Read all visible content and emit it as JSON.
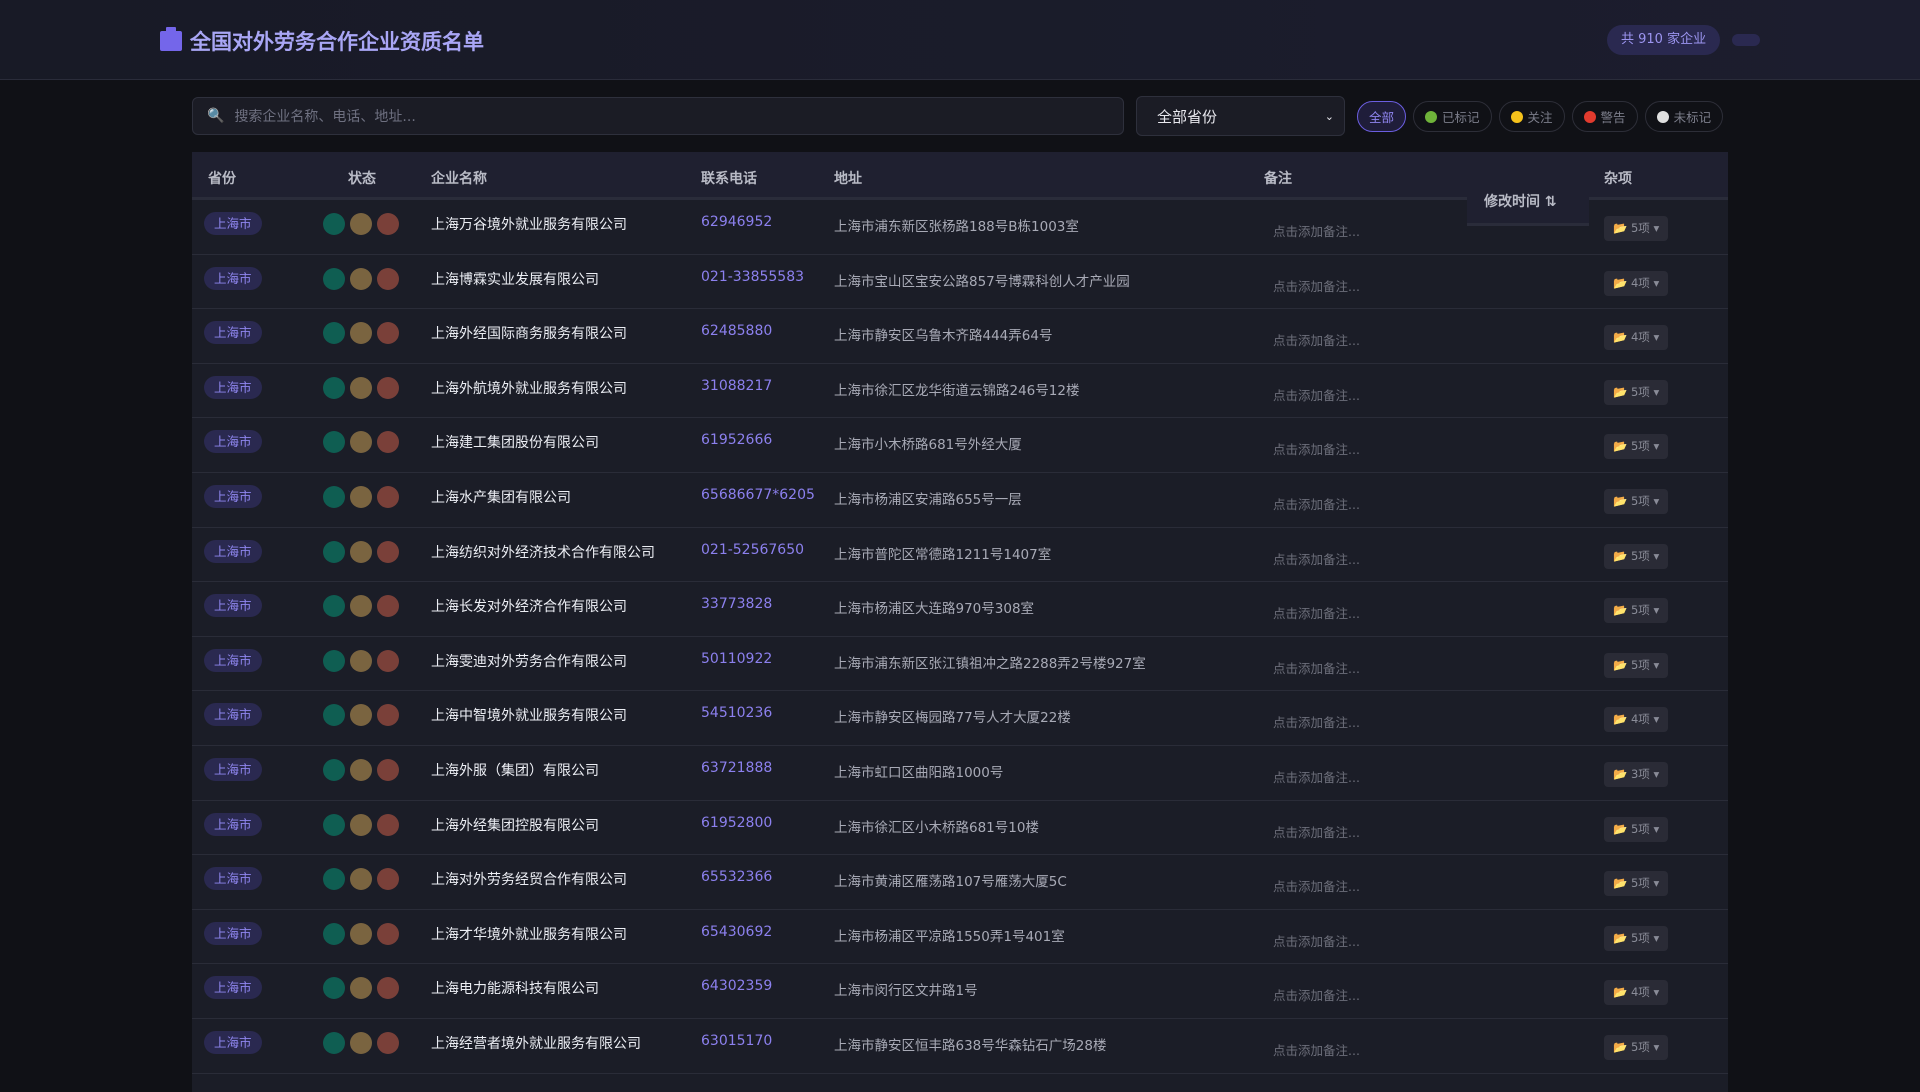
{
  "header": {
    "title": "全国对外劳务合作企业资质名单",
    "count": "共 910 家企业"
  },
  "toolbar": {
    "search_placeholder": "搜索企业名称、电话、地址...",
    "province_select": "全部省份",
    "filters": [
      {
        "label": "全部",
        "active": true
      },
      {
        "label": "已标记",
        "color": "#6fb33a"
      },
      {
        "label": "关注",
        "color": "#f5c21b"
      },
      {
        "label": "警告",
        "color": "#e23b2e"
      },
      {
        "label": "未标记",
        "color": "#e0e0e0"
      }
    ]
  },
  "table": {
    "columns": [
      "省份",
      "状态",
      "企业名称",
      "联系电话",
      "地址",
      "备注",
      "修改时间 ⇅",
      "杂项"
    ],
    "note_placeholder": "点击添加备注...",
    "status_colors": [
      "#0f5e52",
      "#7a6440",
      "#7a4039"
    ],
    "rows": [
      {
        "province": "上海市",
        "name": "上海万谷境外就业服务有限公司",
        "phone": "62946952",
        "address": "上海市浦东新区张杨路188号B栋1003室",
        "misc": "5项"
      },
      {
        "province": "上海市",
        "name": "上海博霖实业发展有限公司",
        "phone": "021-33855583",
        "address": "上海市宝山区宝安公路857号博霖科创人才产业园",
        "misc": "4项"
      },
      {
        "province": "上海市",
        "name": "上海外经国际商务服务有限公司",
        "phone": "62485880",
        "address": "上海市静安区乌鲁木齐路444弄64号",
        "misc": "4项"
      },
      {
        "province": "上海市",
        "name": "上海外航境外就业服务有限公司",
        "phone": "31088217",
        "address": "上海市徐汇区龙华街道云锦路246号12楼",
        "misc": "5项"
      },
      {
        "province": "上海市",
        "name": "上海建工集团股份有限公司",
        "phone": "61952666",
        "address": "上海市小木桥路681号外经大厦",
        "misc": "5项"
      },
      {
        "province": "上海市",
        "name": "上海水产集团有限公司",
        "phone": "65686677*6205",
        "address": "上海市杨浦区安浦路655号一层",
        "misc": "5项"
      },
      {
        "province": "上海市",
        "name": "上海纺织对外经济技术合作有限公司",
        "phone": "021-52567650",
        "address": "上海市普陀区常德路1211号1407室",
        "misc": "5项"
      },
      {
        "province": "上海市",
        "name": "上海长发对外经济合作有限公司",
        "phone": "33773828",
        "address": "上海市杨浦区大连路970号308室",
        "misc": "5项"
      },
      {
        "province": "上海市",
        "name": "上海雯迪对外劳务合作有限公司",
        "phone": "50110922",
        "address": "上海市浦东新区张江镇祖冲之路2288弄2号楼927室",
        "misc": "5项"
      },
      {
        "province": "上海市",
        "name": "上海中智境外就业服务有限公司",
        "phone": "54510236",
        "address": "上海市静安区梅园路77号人才大厦22楼",
        "misc": "4项"
      },
      {
        "province": "上海市",
        "name": "上海外服（集团）有限公司",
        "phone": "63721888",
        "address": "上海市虹口区曲阳路1000号",
        "misc": "3项"
      },
      {
        "province": "上海市",
        "name": "上海外经集团控股有限公司",
        "phone": "61952800",
        "address": "上海市徐汇区小木桥路681号10楼",
        "misc": "5项"
      },
      {
        "province": "上海市",
        "name": "上海对外劳务经贸合作有限公司",
        "phone": "65532366",
        "address": "上海市黄浦区雁荡路107号雁荡大厦5C",
        "misc": "5项"
      },
      {
        "province": "上海市",
        "name": "上海才华境外就业服务有限公司",
        "phone": "65430692",
        "address": "上海市杨浦区平凉路1550弄1号401室",
        "misc": "5项"
      },
      {
        "province": "上海市",
        "name": "上海电力能源科技有限公司",
        "phone": "64302359",
        "address": "上海市闵行区文井路1号",
        "misc": "4项"
      },
      {
        "province": "上海市",
        "name": "上海经营者境外就业服务有限公司",
        "phone": "63015170",
        "address": "上海市静安区恒丰路638号华森钻石广场28楼",
        "misc": "5项"
      }
    ]
  }
}
